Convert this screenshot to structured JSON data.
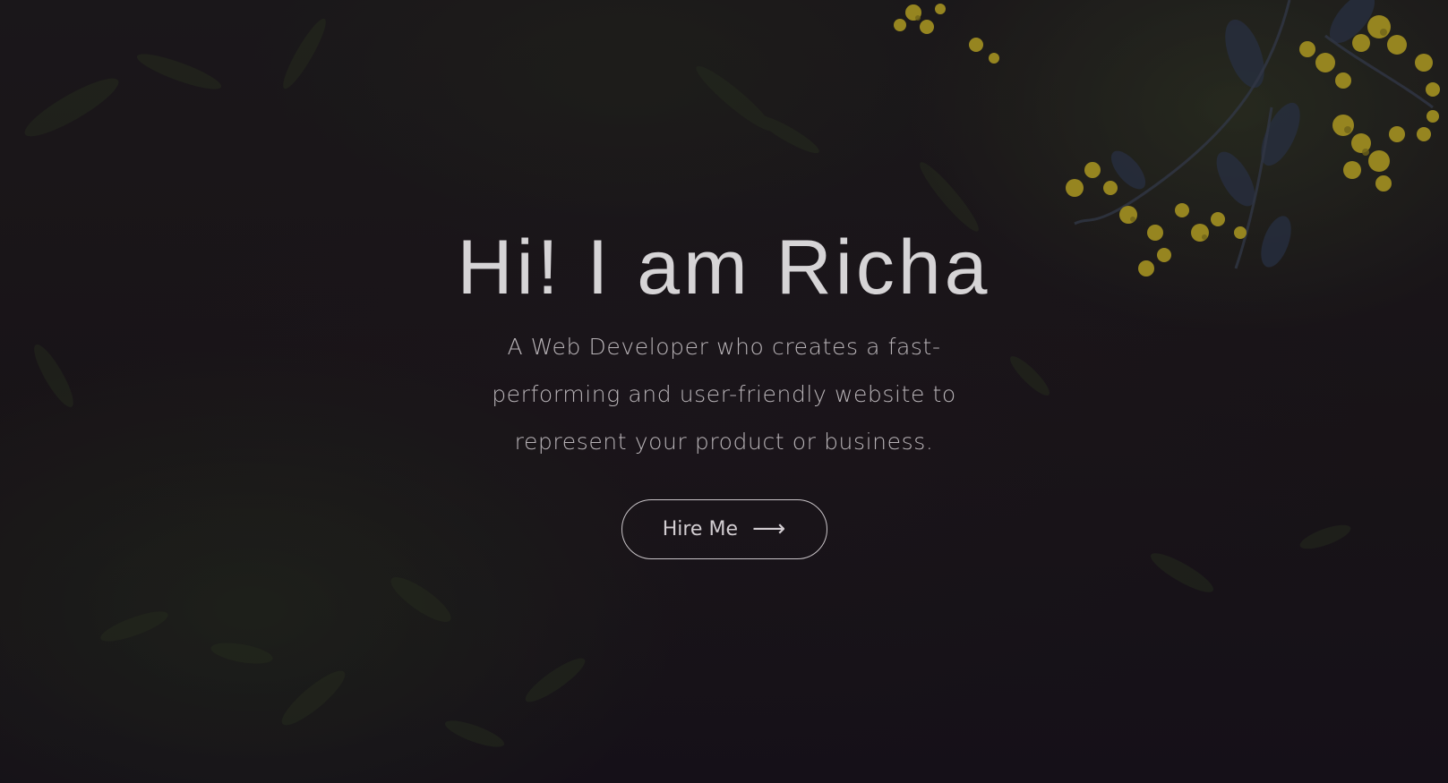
{
  "hero": {
    "title": "Hi! I am Richa",
    "subtitle": "A Web Developer who creates a fast-performing and user-friendly website to represent your product or business.",
    "cta": {
      "label": "Hire Me",
      "icon": "arrow-right-icon"
    }
  },
  "colors": {
    "background": "#17121a",
    "text": "#d6d4d6",
    "flowers": "#c9b52a"
  }
}
